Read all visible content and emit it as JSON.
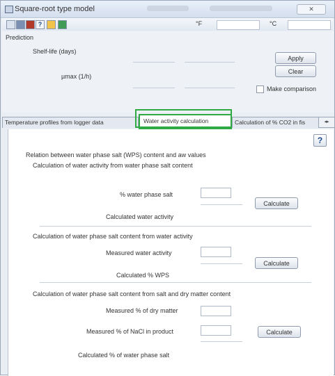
{
  "window": {
    "title": "Square-root type model"
  },
  "prediction": {
    "group_label": "Prediction",
    "shelf_life_label": "Shelf-life (days)",
    "umax_label": "µmax (1/h)",
    "apply_label": "Apply",
    "clear_label": "Clear",
    "make_comparison_label": "Make comparison"
  },
  "toolbar": {
    "temp_unit_1": "°F",
    "temp_unit_2": "°C"
  },
  "tabs": [
    {
      "label": "Temperature profiles from logger data"
    },
    {
      "label": "Water activity calculation"
    },
    {
      "label": "Calculation of % CO2 in fis"
    }
  ],
  "content": {
    "help_label": "?",
    "relation_title": "Relation between water phase salt (WPS) content and aw values",
    "sec1": {
      "title": "Calculation of water activity from water phase salt content",
      "input_label": "% water phase salt",
      "result_label": "Calculated water activity",
      "button_label": "Calculate"
    },
    "sec2": {
      "title": "Calculation of water phase salt content from water activity",
      "input_label": "Measured water activity",
      "result_label": "Calculated % WPS",
      "button_label": "Calculate"
    },
    "sec3": {
      "title": "Calculation of water phase salt content from salt and dry matter content",
      "input1_label": "Measured % of dry matter",
      "input2_label": "Measured % of NaCl in product",
      "result_label": "Calculated % of water phase salt",
      "button_label": "Calculate"
    }
  }
}
